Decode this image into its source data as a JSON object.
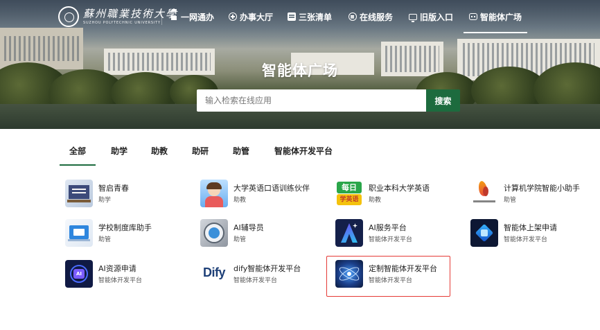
{
  "nav": {
    "logo_cn": "蘇州職業技術大學",
    "logo_en": "SUZHOU POLYTECHNIC UNIVERSITY",
    "items": [
      {
        "label": "一网通办",
        "icon": "home-icon"
      },
      {
        "label": "办事大厅",
        "icon": "plus-circle-icon"
      },
      {
        "label": "三张清单",
        "icon": "list-icon"
      },
      {
        "label": "在线服务",
        "icon": "chat-icon"
      },
      {
        "label": "旧版入口",
        "icon": "monitor-icon"
      },
      {
        "label": "智能体广场",
        "icon": "robot-icon",
        "active": true
      }
    ]
  },
  "hero": {
    "title": "智能体广场",
    "search_placeholder": "输入检索在线应用",
    "search_button": "搜索"
  },
  "tabs": [
    {
      "label": "全部",
      "active": true
    },
    {
      "label": "助学"
    },
    {
      "label": "助教"
    },
    {
      "label": "助研"
    },
    {
      "label": "助管"
    },
    {
      "label": "智能体开发平台"
    }
  ],
  "apps": [
    {
      "title": "智启青春",
      "category": "助学"
    },
    {
      "title": "大学英语口语训练伙伴",
      "category": "助教"
    },
    {
      "title": "职业本科大学英语",
      "category": "助教",
      "icon_text_top": "每日",
      "icon_text_bottom": "学英语"
    },
    {
      "title": "计算机学院智能小助手",
      "category": "助管"
    },
    {
      "title": "学校制度库助手",
      "category": "助管"
    },
    {
      "title": "AI辅导员",
      "category": "助管"
    },
    {
      "title": "AI服务平台",
      "category": "智能体开发平台"
    },
    {
      "title": "智能体上架申请",
      "category": "智能体开发平台"
    },
    {
      "title": "AI资源申请",
      "category": "智能体开发平台",
      "icon_text": "AI"
    },
    {
      "title": "dify智能体开发平台",
      "category": "智能体开发平台",
      "icon_text": "Dify"
    },
    {
      "title": "定制智能体开发平台",
      "category": "智能体开发平台",
      "highlighted": true
    }
  ],
  "colors": {
    "accent": "#1d6b3e",
    "highlight_border": "#e53935"
  }
}
